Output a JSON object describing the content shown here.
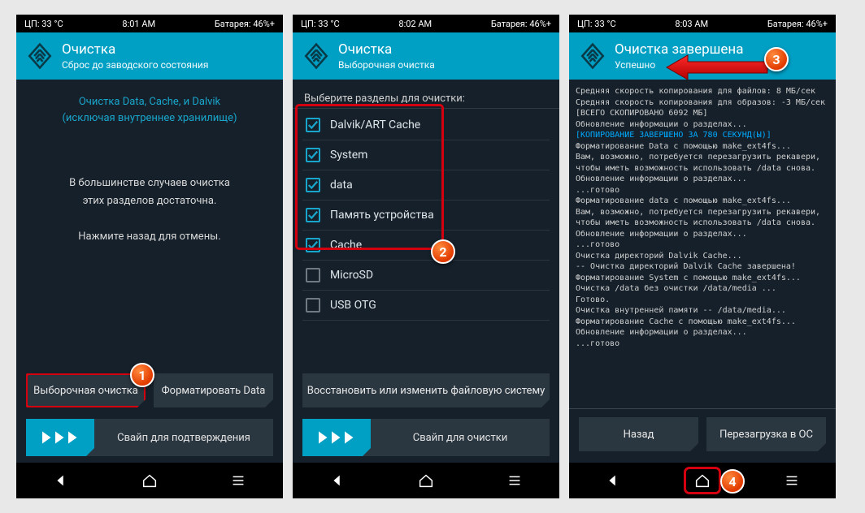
{
  "status": {
    "cpu_label": "ЦП:",
    "temp": "33 °C",
    "battery_label": "Батарея:",
    "battery": "46%+"
  },
  "times": [
    "8:01 AM",
    "8:02 AM",
    "8:03 AM"
  ],
  "screen1": {
    "title": "Очистка",
    "subtitle": "Сброс до заводского состояния",
    "info1_l1": "Очистка Data, Cache, и Dalvik",
    "info1_l2": "(исключая внутреннее хранилище)",
    "info2_l1": "В большинстве случаев очистка",
    "info2_l2": "этих разделов достаточна.",
    "info2_l3": "Нажмите назад для отмены.",
    "btn_selective": "Выборочная очистка",
    "btn_format": "Форматировать Data",
    "swipe": "Свайп для подтверждения"
  },
  "screen2": {
    "title": "Очистка",
    "subtitle": "Выборочная очистка",
    "section": "Выберите разделы для очистки:",
    "partitions": [
      {
        "label": "Dalvik/ART Cache",
        "checked": true
      },
      {
        "label": "System",
        "checked": true
      },
      {
        "label": "data",
        "checked": true
      },
      {
        "label": "Память устройства",
        "checked": true
      },
      {
        "label": "Cache",
        "checked": true
      },
      {
        "label": "MicroSD",
        "checked": false
      },
      {
        "label": "USB OTG",
        "checked": false
      }
    ],
    "btn_fs": "Восстановить или изменить файловую систему",
    "swipe": "Свайп для очистки"
  },
  "screen3": {
    "title": "Очистка завершена",
    "subtitle": "Успешно",
    "log_lines": [
      {
        "t": "Средняя скорость копирования для файлов: 8 МБ/сек"
      },
      {
        "t": "Средняя скорость копирования для образов: -3 МБ/сек"
      },
      {
        "t": "[ВСЕГО СКОПИРОВАНО 6092 МБ]"
      },
      {
        "t": "Обновление информации о разделах..."
      },
      {
        "t": "[КОПИРОВАНИЕ ЗАВЕРШЕНО ЗА 780 СЕКУНД(Ы)]",
        "c": "cyan"
      },
      {
        "t": "Форматирование Data с помощью make_ext4fs..."
      },
      {
        "t": "Вам, возможно, потребуется перезагрузить рекавери,"
      },
      {
        "t": "чтобы иметь возможность использовать /data снова."
      },
      {
        "t": "Обновление информации о разделах..."
      },
      {
        "t": "...готово"
      },
      {
        "t": "Форматирование data с помощью make_ext4fs..."
      },
      {
        "t": "Вам, возможно, потребуется перезагрузить рекавери,"
      },
      {
        "t": "чтобы иметь возможность использовать /data снова."
      },
      {
        "t": "Обновление информации о разделах..."
      },
      {
        "t": "...готово"
      },
      {
        "t": "Очистка директорий Dalvik Cache..."
      },
      {
        "t": "-- Очистка директорий Dalvik Cache завершена!"
      },
      {
        "t": "Форматирование System с помощью make_ext4fs..."
      },
      {
        "t": "Очистка /data без очистки /data/media ..."
      },
      {
        "t": "Готово."
      },
      {
        "t": "Очистка внутренней памяти -- /data/media..."
      },
      {
        "t": "Форматирование Cache с помощью make_ext4fs..."
      },
      {
        "t": "Обновление информации о разделах..."
      },
      {
        "t": "...готово"
      }
    ],
    "btn_back": "Назад",
    "btn_reboot": "Перезагрузка в ОС"
  },
  "badges": {
    "b1": "1",
    "b2": "2",
    "b3": "3",
    "b4": "4"
  }
}
